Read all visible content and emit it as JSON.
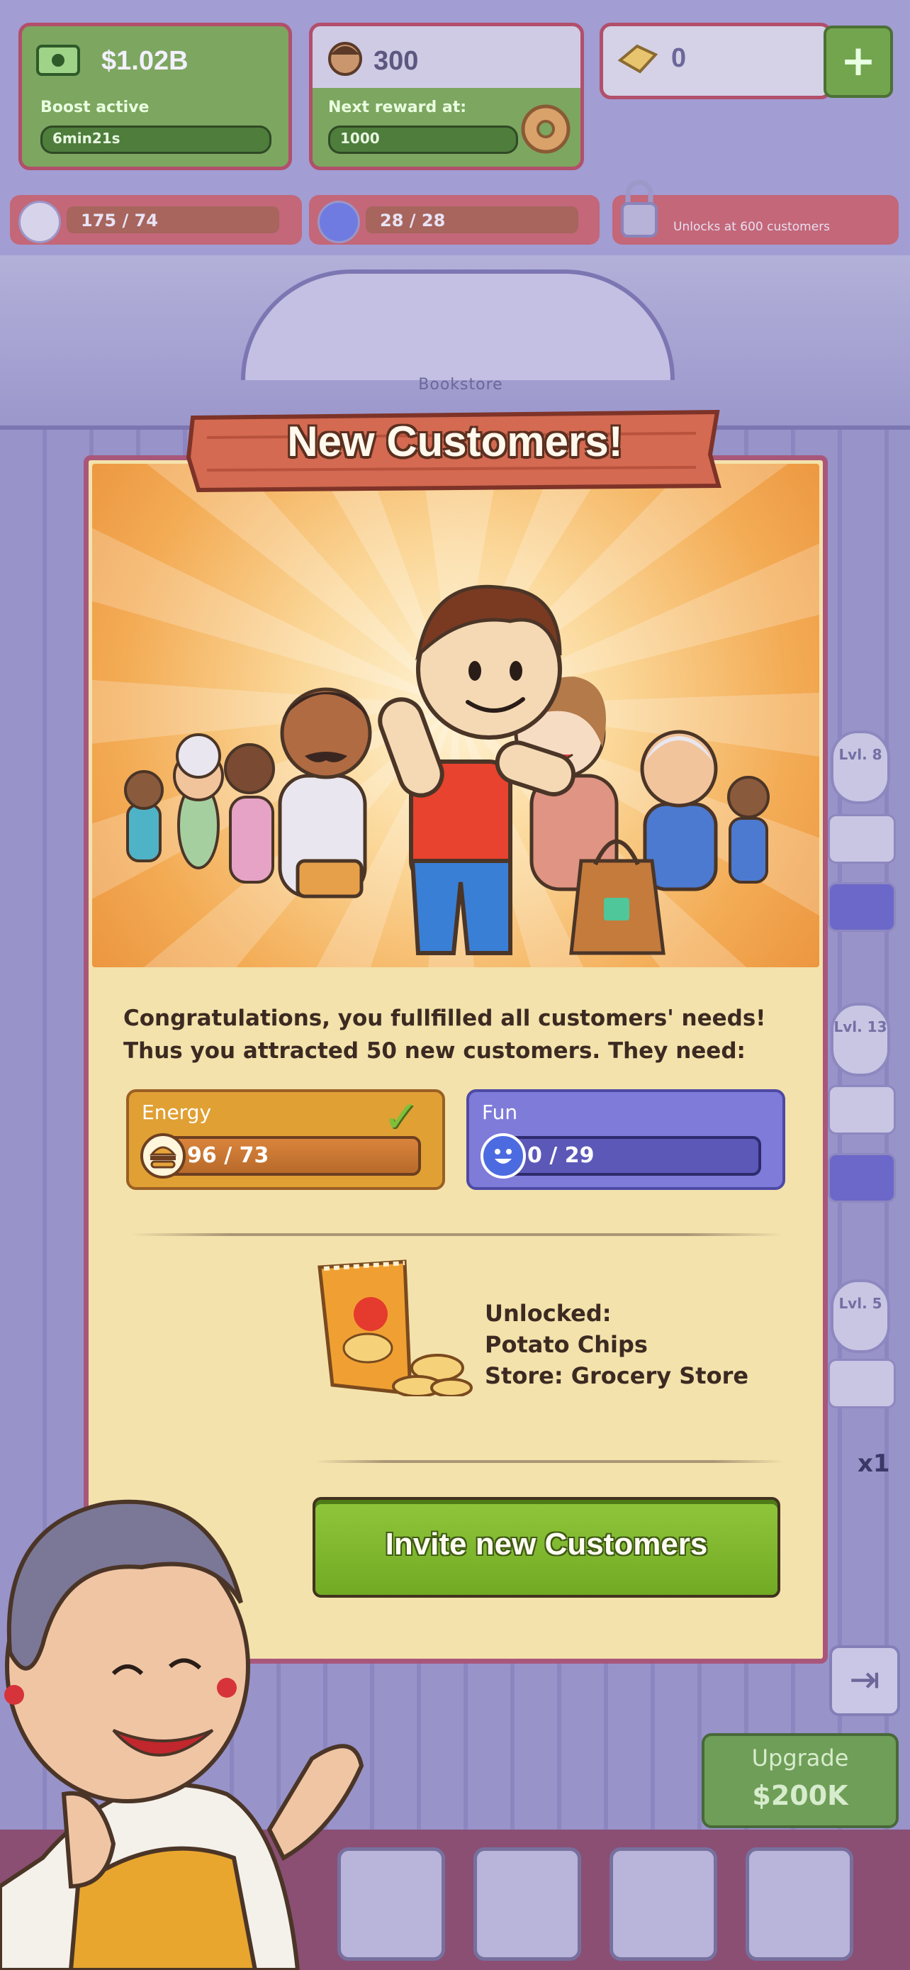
{
  "top_bar": {
    "money": {
      "value": "$1.02B",
      "label": "Boost active",
      "timer": "6min21s"
    },
    "customers": {
      "value": "300",
      "label": "Next reward at:",
      "next": "1000"
    },
    "gems": {
      "value": "0",
      "plus": "+"
    }
  },
  "needs_bar": {
    "energy": "175 / 74",
    "fun": "28 / 28",
    "locked": "Unlocks at 600 customers"
  },
  "store_name": "Bookstore",
  "side": {
    "lvl1": "Lvl. 8",
    "lvl2": "Lvl. 13",
    "lvl3": "Lvl. 5",
    "multiplier": "x1"
  },
  "upgrade": {
    "label": "Upgrade",
    "price": "$200K"
  },
  "dialog": {
    "title": "New Customers!",
    "message": "Congratulations, you fullfilled all customers' needs! Thus you attracted 50 new customers. They need:",
    "needs": [
      {
        "name": "Energy",
        "value": "96 / 73",
        "done": true
      },
      {
        "name": "Fun",
        "value": "0 / 29",
        "done": false
      }
    ],
    "unlocked_label": "Unlocked:",
    "unlocked_item": "Potato Chips",
    "unlocked_store": "Store: Grocery Store",
    "button": "Invite new Customers"
  },
  "colors": {
    "primary_button": "#7fb830",
    "energy": "#e0a034",
    "fun": "#7e7bd9",
    "dialog_bg": "#f3e2ab"
  },
  "icons": [
    "money-icon",
    "customer-icon",
    "gem-icon",
    "plus-icon",
    "burger-icon",
    "smiley-icon",
    "lock-icon",
    "check-icon",
    "exit-icon",
    "chips-icon"
  ]
}
